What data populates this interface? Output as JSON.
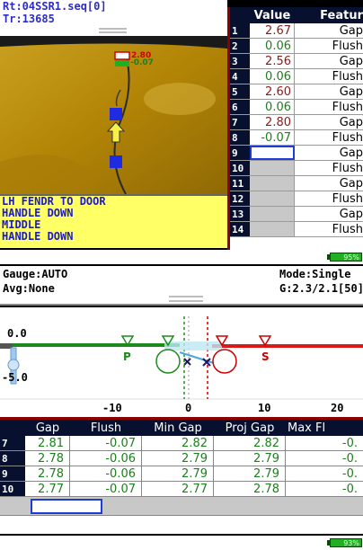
{
  "top_info": {
    "line1": "Rt:04SSR1.seq[0]",
    "line2": "Tr:13685"
  },
  "camera": {
    "overlay_gap": "2.80",
    "overlay_flush": "-0.07"
  },
  "part_label": {
    "lines": [
      "LH FENDR TO DOOR",
      "HANDLE DOWN",
      "MIDDLE",
      "HANDLE DOWN"
    ]
  },
  "right_table": {
    "headers": {
      "value": "Value",
      "feature": "Featur"
    },
    "rows": [
      {
        "num": "1",
        "value": "2.67",
        "feature": "Gap",
        "color": "#8b1a1a"
      },
      {
        "num": "2",
        "value": "0.06",
        "feature": "Flush",
        "color": "#1e7d1e"
      },
      {
        "num": "3",
        "value": "2.56",
        "feature": "Gap",
        "color": "#8b1a1a"
      },
      {
        "num": "4",
        "value": "0.06",
        "feature": "Flush",
        "color": "#1e7d1e"
      },
      {
        "num": "5",
        "value": "2.60",
        "feature": "Gap",
        "color": "#8b1a1a"
      },
      {
        "num": "6",
        "value": "0.06",
        "feature": "Flush",
        "color": "#1e7d1e"
      },
      {
        "num": "7",
        "value": "2.80",
        "feature": "Gap",
        "color": "#8b1a1a"
      },
      {
        "num": "8",
        "value": "-0.07",
        "feature": "Flush",
        "color": "#1e7d1e"
      },
      {
        "num": "9",
        "value": "",
        "feature": "Gap",
        "color": "#000"
      },
      {
        "num": "10",
        "value": "",
        "feature": "Flush",
        "color": "#000"
      },
      {
        "num": "11",
        "value": "",
        "feature": "Gap",
        "color": "#000"
      },
      {
        "num": "12",
        "value": "",
        "feature": "Flush",
        "color": "#000"
      },
      {
        "num": "13",
        "value": "",
        "feature": "Gap",
        "color": "#000"
      },
      {
        "num": "14",
        "value": "",
        "feature": "Flush",
        "color": "#000"
      }
    ]
  },
  "battery_top": "95%",
  "gauge_header": {
    "gauge": "Gauge:AUTO",
    "mode": "Mode:Single",
    "avg": "Avg:None",
    "g": "G:2.3/2.1[50]"
  },
  "profile": {
    "y_labels": [
      "0.0",
      "-5.0"
    ],
    "x_labels": [
      "-10",
      "0",
      "10",
      "20"
    ],
    "p_label": "P",
    "s_label": "S"
  },
  "bottom_table": {
    "headers": [
      "Gap",
      "Flush",
      "Min Gap",
      "Proj Gap",
      "Max Fl"
    ],
    "rows": [
      {
        "num": "7",
        "cells": [
          "2.81",
          "-0.07",
          "2.82",
          "2.82",
          "-0."
        ]
      },
      {
        "num": "8",
        "cells": [
          "2.78",
          "-0.06",
          "2.79",
          "2.79",
          "-0."
        ]
      },
      {
        "num": "9",
        "cells": [
          "2.78",
          "-0.06",
          "2.79",
          "2.79",
          "-0."
        ]
      },
      {
        "num": "10",
        "cells": [
          "2.77",
          "-0.07",
          "2.77",
          "2.78",
          "-0."
        ]
      }
    ]
  },
  "battery_bottom": "93%"
}
